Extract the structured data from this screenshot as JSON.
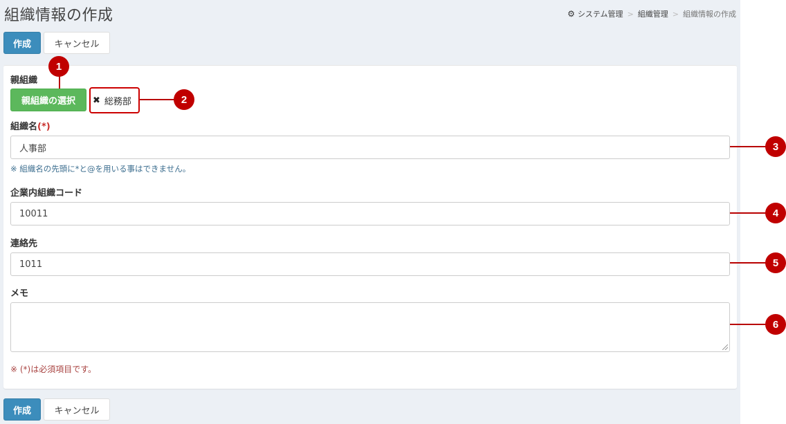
{
  "page": {
    "title": "組織情報の作成"
  },
  "breadcrumb": {
    "icon": "gear-icon",
    "items": [
      "システム管理",
      "組織管理",
      "組織情報の作成"
    ],
    "separator": ">"
  },
  "actions": {
    "create_label": "作成",
    "cancel_label": "キャンセル"
  },
  "form": {
    "parent": {
      "label": "親組織",
      "select_button": "親組織の選択",
      "selected_value": "総務部",
      "remove_icon": "close-icon"
    },
    "name": {
      "label": "組織名",
      "required_mark": "(*)",
      "value": "人事部",
      "help": "※ 組織名の先頭に*と@を用いる事はできません。"
    },
    "code": {
      "label": "企業内組織コード",
      "value": "10011"
    },
    "contact": {
      "label": "連絡先",
      "value": "1011"
    },
    "memo": {
      "label": "メモ",
      "value": ""
    },
    "required_note": "※ (*)は必須項目です。"
  },
  "callouts": [
    "1",
    "2",
    "3",
    "4",
    "5",
    "6"
  ],
  "colors": {
    "primary": "#3c8dbc",
    "success": "#5cb85c",
    "callout": "#c00000",
    "background": "#ecf0f5"
  }
}
